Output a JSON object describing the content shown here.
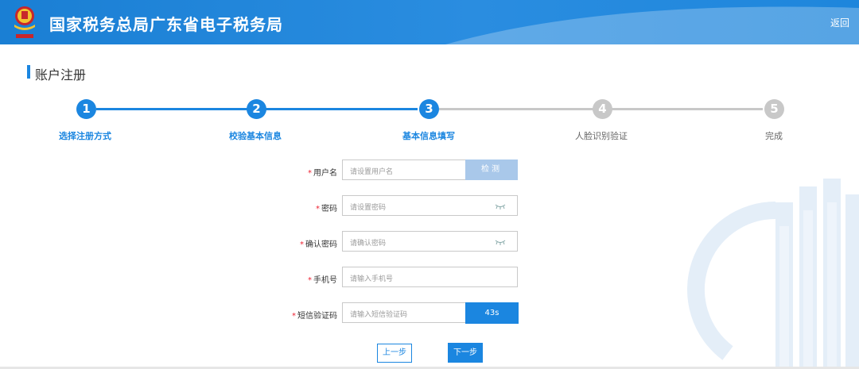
{
  "header": {
    "title": "国家税务总局广东省电子税务局",
    "back_label": "返回"
  },
  "section": {
    "title": "账户注册"
  },
  "steps": [
    {
      "number": "1",
      "label": "选择注册方式",
      "state": "completed"
    },
    {
      "number": "2",
      "label": "校验基本信息",
      "state": "completed"
    },
    {
      "number": "3",
      "label": "基本信息填写",
      "state": "current"
    },
    {
      "number": "4",
      "label": "人脸识别验证",
      "state": "pending"
    },
    {
      "number": "5",
      "label": "完成",
      "state": "pending"
    }
  ],
  "form": {
    "required_mark": "*",
    "username": {
      "label": "用户名",
      "placeholder": "请设置用户名",
      "check_label": "检测"
    },
    "password": {
      "label": "密码",
      "placeholder": "请设置密码"
    },
    "confirm_password": {
      "label": "确认密码",
      "placeholder": "请确认密码"
    },
    "phone": {
      "label": "手机号",
      "placeholder": "请输入手机号"
    },
    "sms_code": {
      "label": "短信验证码",
      "placeholder": "请输入短信验证码",
      "countdown": "43s"
    }
  },
  "actions": {
    "prev_label": "上一步",
    "next_label": "下一步"
  },
  "colors": {
    "primary": "#1b86e0",
    "header": "#1a7fd4",
    "inactive": "#c8c8c8",
    "required": "#ee2233"
  }
}
